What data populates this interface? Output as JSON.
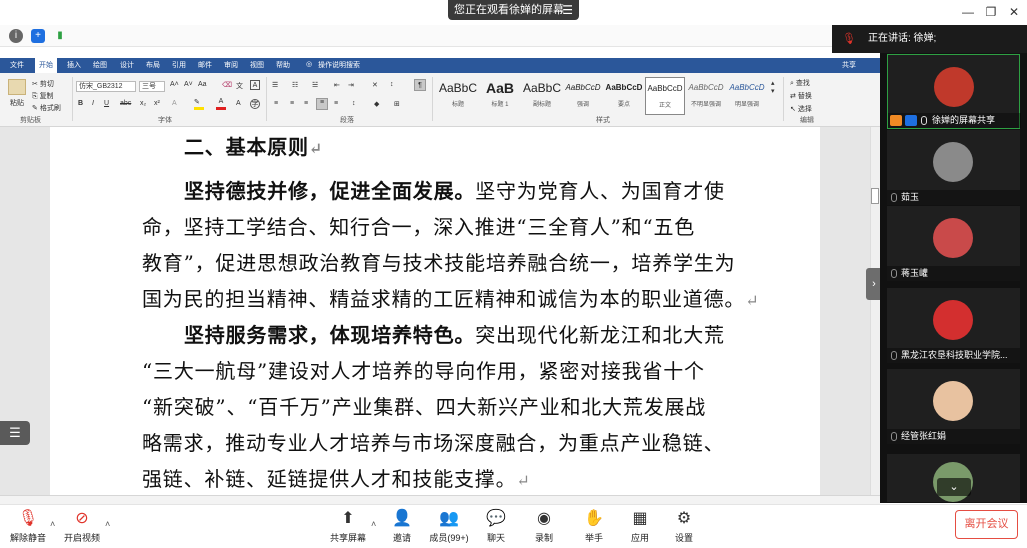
{
  "meeting": {
    "share_banner": "您正在观看徐婵的屏幕",
    "speaking_label": "正在讲话: 徐婵;"
  },
  "ribbon": {
    "tabs": [
      "文件",
      "开始",
      "插入",
      "绘图",
      "设计",
      "布局",
      "引用",
      "邮件",
      "审阅",
      "视图",
      "帮助",
      "操作说明搜索"
    ],
    "share": "共享",
    "clipboard": {
      "paste": "粘贴",
      "cut": "剪切",
      "copy": "复制",
      "format_painter": "格式刷",
      "label": "剪贴板"
    },
    "font": {
      "name": "仿宋_GB2312",
      "size": "三号",
      "label": "字体"
    },
    "paragraph_label": "段落",
    "styles": [
      {
        "sample": "AaBbC",
        "name": "标题"
      },
      {
        "sample": "AaB",
        "name": "标题 1"
      },
      {
        "sample": "AaBbC",
        "name": "副标题"
      },
      {
        "sample": "AaBbCcD",
        "name": "强调"
      },
      {
        "sample": "AaBbCcD",
        "name": "要点"
      },
      {
        "sample": "AaBbCcD",
        "name": "正文"
      },
      {
        "sample": "AaBbCcD",
        "name": "不明显强调"
      },
      {
        "sample": "AaBbCcD",
        "name": "明显强调"
      }
    ],
    "styles_label": "样式",
    "editing": {
      "find": "查找",
      "replace": "替换",
      "select": "选择",
      "label": "编辑"
    }
  },
  "document": {
    "heading": "二、基本原则",
    "p1_bold": "坚持德技并修，促进全面发展。",
    "p1_line1_rest": "坚守为党育人、为国育才使",
    "p1_line2": "命，坚持工学结合、知行合一，深入推进“三全育人”和“五色",
    "p1_line3": "教育”，促进思想政治教育与技术技能培养融合统一，培养学生为",
    "p1_line4": "国为民的担当精神、精益求精的工匠精神和诚信为本的职业道德。",
    "p2_bold": "坚持服务需求，体现培养特色。",
    "p2_line1_rest": "突出现代化新龙江和北大荒",
    "p2_line2": "“三大一航母”建设对人才培养的导向作用，紧密对接我省十个",
    "p2_line3": "“新突破”、“百千万”产业集群、四大新兴产业和北大荒发展战",
    "p2_line4": "略需求，推动专业人才培养与市场深度融合，为重点产业稳链、",
    "p2_line5": "强链、补链、延链提供人才和技能支撑。",
    "pmark": "↵"
  },
  "participants": [
    {
      "name": "徐婵的屏幕共享",
      "avatar_color": "#c0392b"
    },
    {
      "name": "茹玉",
      "avatar_color": "#8a8a8a"
    },
    {
      "name": "蒋玉巏",
      "avatar_color": "#c94a4a"
    },
    {
      "name": "黑龙江农垦科技职业学院...",
      "avatar_color": "#d32f2f"
    },
    {
      "name": "经管张红娟",
      "avatar_color": "#e8c2a0"
    },
    {
      "name": "",
      "avatar_color": "#7a9a6a"
    }
  ],
  "toolbar": {
    "unmute": "解除静音",
    "start_video": "开启视频",
    "share_screen": "共享屏幕",
    "invite": "邀请",
    "members": "成员(99+)",
    "chat": "聊天",
    "record": "录制",
    "raise_hand": "举手",
    "apps": "应用",
    "settings": "设置",
    "leave": "离开会议"
  },
  "colors": {
    "ribbon_blue": "#2b579a",
    "leave_red": "#e54d42",
    "mute_red": "#e0332a"
  }
}
